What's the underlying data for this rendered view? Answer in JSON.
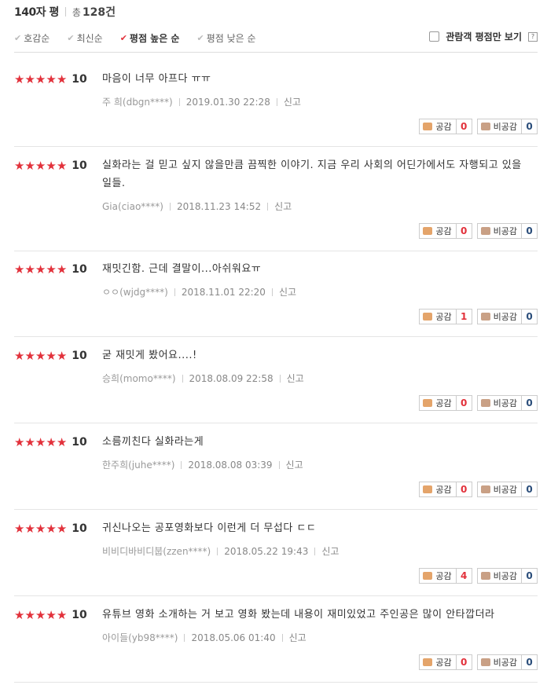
{
  "header": {
    "title": "140자 평",
    "total_label": "총",
    "total_count": "128건"
  },
  "sort": {
    "options": [
      {
        "label": "호감순",
        "active": false
      },
      {
        "label": "최신순",
        "active": false
      },
      {
        "label": "평점 높은 순",
        "active": true
      },
      {
        "label": "평점 낮은 순",
        "active": false
      }
    ],
    "viewer_only_label": "관람객 평점만 보기",
    "help_glyph": "?"
  },
  "labels": {
    "like": "공감",
    "dislike": "비공감",
    "report": "신고"
  },
  "colors": {
    "accent": "#e2313b",
    "dislike_count": "#2a4d7a"
  },
  "reviews": [
    {
      "score": "10",
      "text": "마음이 너무 아프다 ㅠㅠ",
      "user": "주 희(dbgn****)",
      "date": "2019.01.30 22:28",
      "likes": "0",
      "dislikes": "0"
    },
    {
      "score": "10",
      "text": "실화라는 걸 믿고 싶지 않을만큼 끔찍한 이야기. 지금 우리 사회의 어딘가에서도 자행되고 있을 일들.",
      "user": "Gia(ciao****)",
      "date": "2018.11.23 14:52",
      "likes": "0",
      "dislikes": "0"
    },
    {
      "score": "10",
      "text": "재밋긴함. 근데 결말이...아쉬워요ㅠ",
      "user": "ㅇㅇ(wjdg****)",
      "date": "2018.11.01 22:20",
      "likes": "1",
      "dislikes": "0"
    },
    {
      "score": "10",
      "text": "굳 재밋게 봤어요....!",
      "user": "승희(momo****)",
      "date": "2018.08.09 22:58",
      "likes": "0",
      "dislikes": "0"
    },
    {
      "score": "10",
      "text": "소름끼친다 실화라는게",
      "user": "한주희(juhe****)",
      "date": "2018.08.08 03:39",
      "likes": "0",
      "dislikes": "0"
    },
    {
      "score": "10",
      "text": "귀신나오는 공포영화보다 이런게 더 무섭다 ㄷㄷ",
      "user": "비비디바비디붑(zzen****)",
      "date": "2018.05.22 19:43",
      "likes": "4",
      "dislikes": "0"
    },
    {
      "score": "10",
      "text": "유튜브 영화 소개하는 거 보고 영화 봤는데 내용이 재미있었고 주인공은 많이 안타깝더라",
      "user": "아이들(yb98****)",
      "date": "2018.05.06 01:40",
      "likes": "0",
      "dislikes": "0"
    }
  ]
}
